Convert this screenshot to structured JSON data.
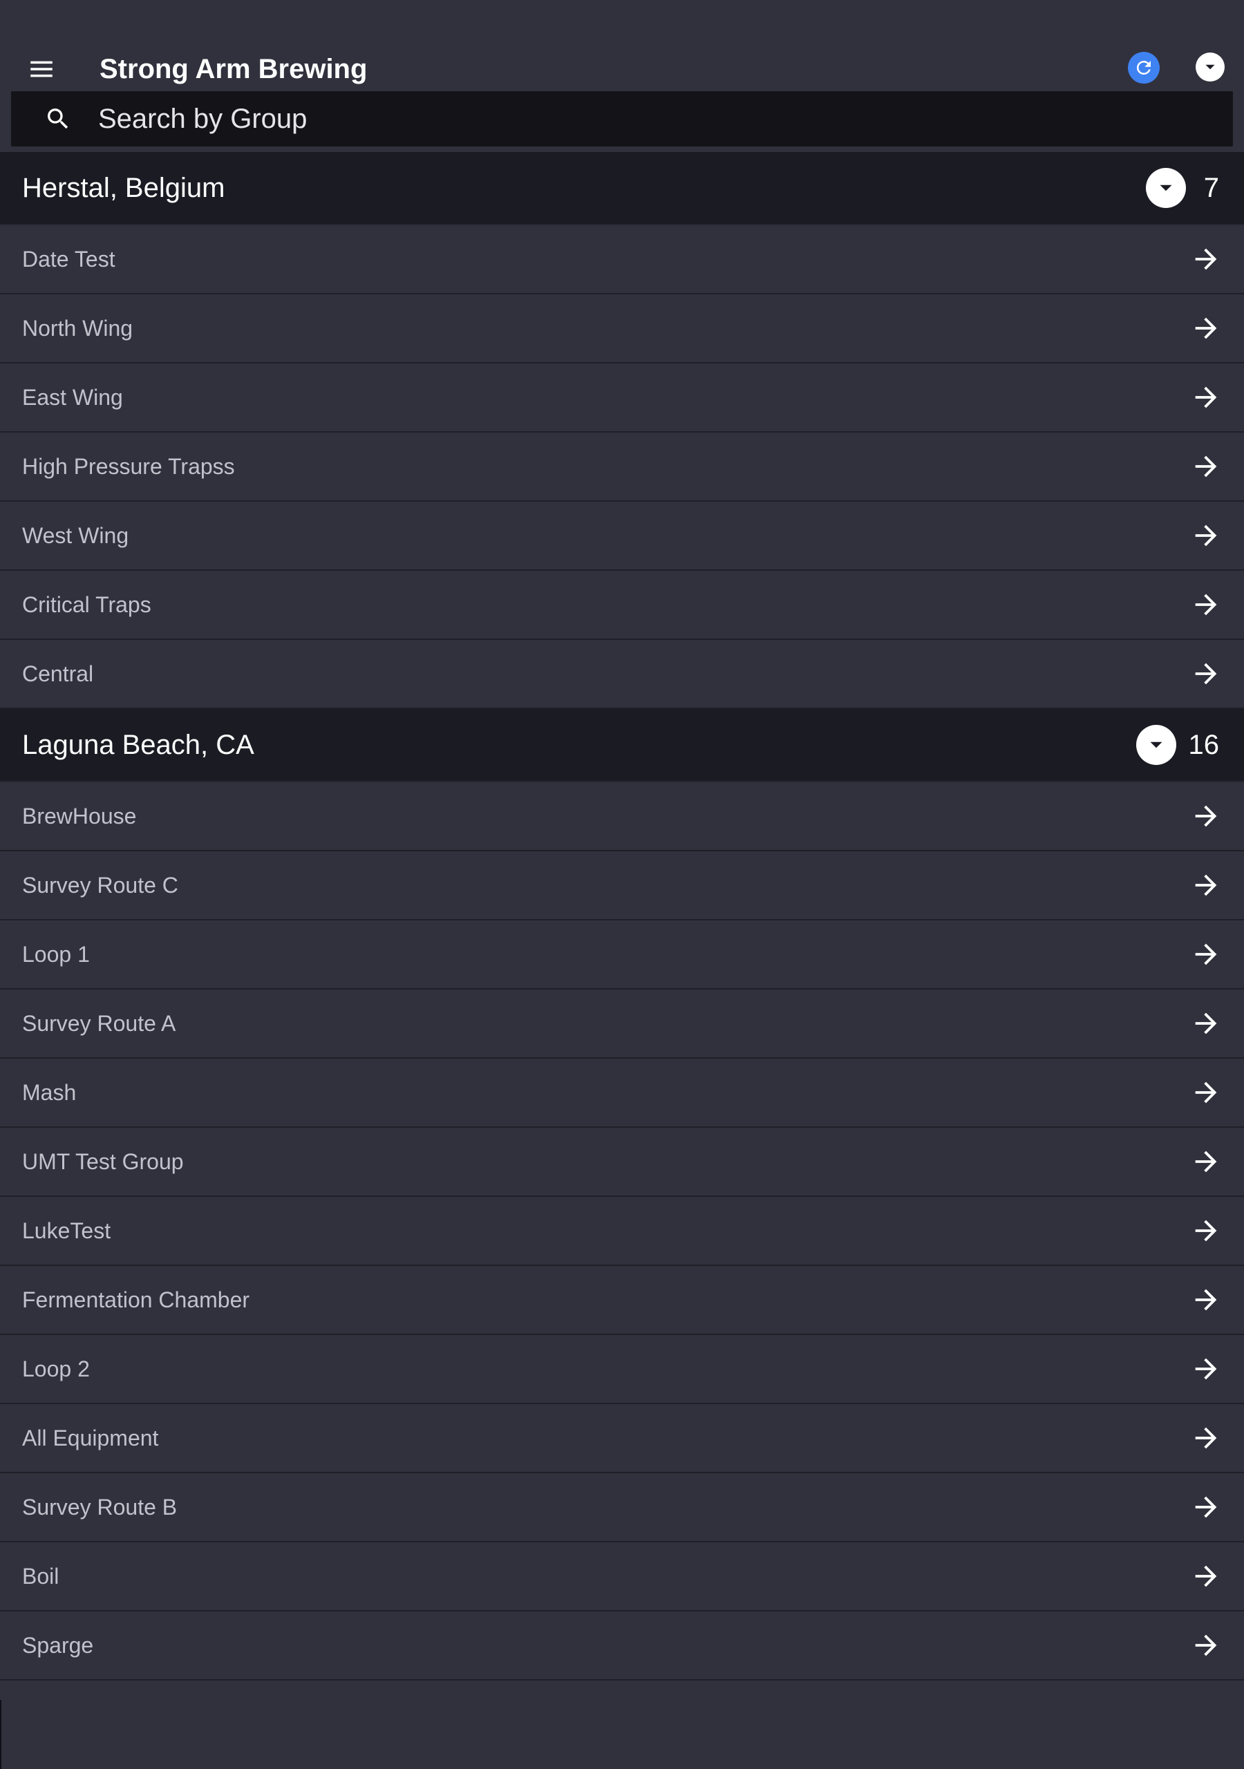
{
  "app": {
    "title": "Strong Arm Brewing",
    "icons": {
      "menu": "menu-icon",
      "refresh": "refresh-icon",
      "account": "chevron-down-icon"
    }
  },
  "search": {
    "placeholder": "Search by Group",
    "value": ""
  },
  "sections": [
    {
      "title": "Herstal, Belgium",
      "count": "7",
      "items": [
        "Date Test",
        "North Wing",
        "East Wing",
        "High Pressure Trapss",
        "West Wing",
        "Critical Traps",
        "Central"
      ]
    },
    {
      "title": "Laguna Beach, CA",
      "count": "16",
      "items": [
        "BrewHouse",
        "Survey Route C",
        "Loop 1",
        "Survey Route A",
        "Mash",
        "UMT Test Group",
        "LukeTest",
        "Fermentation Chamber",
        "Loop 2",
        "All Equipment",
        "Survey Route B",
        "Boil",
        "Sparge"
      ]
    }
  ],
  "colors": {
    "background": "#31313d",
    "header_background": "#1b1b23",
    "search_background": "#141418",
    "accent": "#3f82f2",
    "item_text": "#c2c2cc"
  }
}
